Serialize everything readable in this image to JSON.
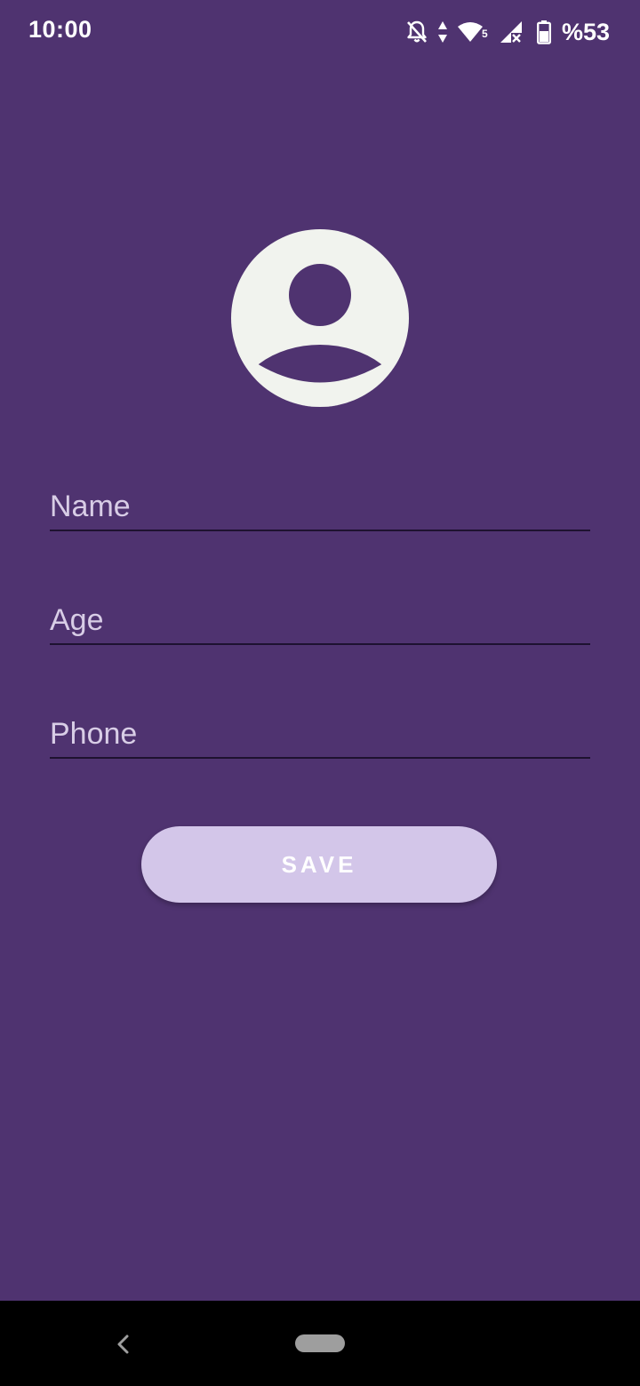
{
  "status_bar": {
    "time": "10:00",
    "battery_text": "%53",
    "icons": [
      "bell-off-icon",
      "data-arrows-icon",
      "wifi-icon",
      "signal-icon",
      "battery-icon"
    ],
    "wifi_badge": "5"
  },
  "avatar": {
    "icon": "account-circle-icon",
    "color": "#f1f3ee"
  },
  "form": {
    "name": {
      "value": "",
      "placeholder": "Name"
    },
    "age": {
      "value": "",
      "placeholder": "Age"
    },
    "phone": {
      "value": "",
      "placeholder": "Phone"
    }
  },
  "save_button": {
    "label": "SAVE",
    "color": "#d3c6e9"
  },
  "nav_bar": {
    "icons": [
      "back-icon",
      "home-pill-icon"
    ]
  },
  "colors": {
    "background": "#4f3370",
    "underline": "#1e1230",
    "text": "#ffffff"
  }
}
